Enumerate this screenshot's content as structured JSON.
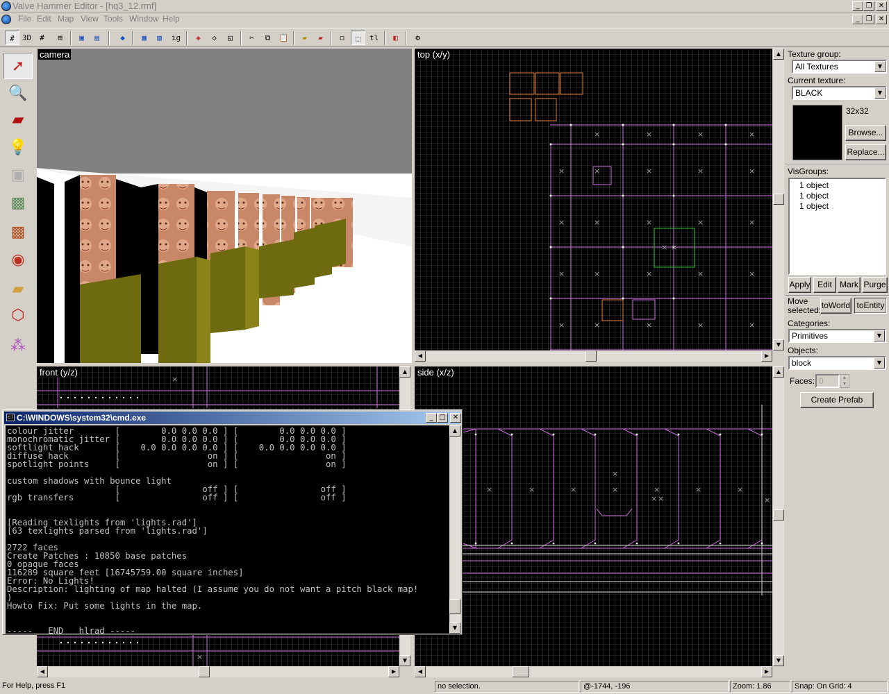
{
  "window": {
    "title": "Valve Hammer Editor - [hq3_12.rmf]"
  },
  "menu": [
    "File",
    "Edit",
    "Map",
    "View",
    "Tools",
    "Window",
    "Help"
  ],
  "viewports": {
    "camera": "camera",
    "top": "top (x/y)",
    "front": "front (y/z)",
    "side": "side (x/z)"
  },
  "panel": {
    "texture_group_label": "Texture group:",
    "texture_group": "All Textures",
    "current_texture_label": "Current texture:",
    "current_texture": "BLACK",
    "texture_size": "32x32",
    "browse": "Browse...",
    "replace": "Replace...",
    "visgroups_label": "VisGroups:",
    "visgroups": [
      "1 object",
      "1 object",
      "1 object"
    ],
    "apply": "Apply",
    "edit": "Edit",
    "mark": "Mark",
    "purge": "Purge",
    "move_selected": "Move selected:",
    "to_world": "toWorld",
    "to_entity": "toEntity",
    "categories_label": "Categories:",
    "categories": "Primitives",
    "objects_label": "Objects:",
    "objects": "block",
    "faces_label": "Faces:",
    "faces": "0",
    "create_prefab": "Create Prefab"
  },
  "cmd": {
    "title": "C:\\WINDOWS\\system32\\cmd.exe",
    "lines": [
      "colour jitter        [        0.0 0.0 0.0 ] [        0.0 0.0 0.0 ]",
      "monochromatic jitter [        0.0 0.0 0.0 ] [        0.0 0.0 0.0 ]",
      "softlight hack       [    0.0 0.0 0.0 0.0 ] [    0.0 0.0 0.0 0.0 ]",
      "diffuse hack         [                 on ] [                 on ]",
      "spotlight points     [                 on ] [                 on ]",
      "",
      "custom shadows with bounce light",
      "                     [                off ] [                off ]",
      "rgb transfers        [                off ] [                off ]",
      "",
      "",
      "[Reading texlights from 'lights.rad']",
      "[63 texlights parsed from 'lights.rad']",
      "",
      "2722 faces",
      "Create Patches : 10850 base patches",
      "0 opaque faces",
      "116289 square feet [16745759.00 square inches]",
      "Error: No Lights!",
      "Description: lighting of map halted (I assume you do not want a pitch black map!",
      ")",
      "Howto Fix: Put some lights in the map.",
      "",
      "",
      "-----   END   hlrad -----"
    ]
  },
  "status": {
    "help": "For Help, press F1",
    "selection": "no selection.",
    "coords": "@-1744, -196",
    "zoom": "Zoom: 1.86",
    "snap": "Snap: On Grid: 4"
  }
}
